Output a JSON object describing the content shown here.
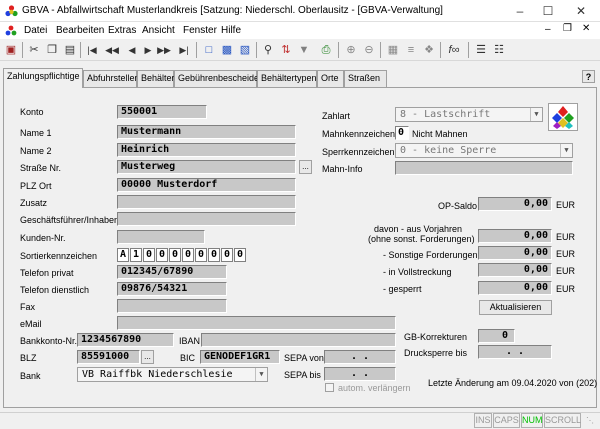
{
  "window": {
    "title": "GBVA - Abfallwirtschaft Musterlandkreis [Satzung: Niederschl. Oberlausitz - [GBVA-Verwaltung]"
  },
  "menu": [
    "Datei",
    "Bearbeiten",
    "Extras",
    "Ansicht",
    "Fenster",
    "Hilfe"
  ],
  "tabs": [
    "Zahlungspflichtige",
    "Abfuhrstellen",
    "Behälter",
    "Gebührenbescheide",
    "Behältertypen",
    "Orte",
    "Straßen"
  ],
  "help_label": "?",
  "form": {
    "konto": {
      "label": "Konto",
      "value": "550001"
    },
    "name1": {
      "label": "Name 1",
      "value": "Mustermann"
    },
    "name2": {
      "label": "Name 2",
      "value": "Heinrich"
    },
    "strasse": {
      "label": "Straße Nr.",
      "value": "Musterweg"
    },
    "plz_ort": {
      "label": "PLZ Ort",
      "value": "00000  Musterdorf"
    },
    "zusatz": {
      "label": "Zusatz",
      "value": ""
    },
    "geschaeftsfuehrer": {
      "label": "Geschäftsführer/Inhaber",
      "value": ""
    },
    "kunden_nr": {
      "label": "Kunden-Nr.",
      "value": ""
    },
    "sortierkennzeichen": {
      "label": "Sortierkennzeichen",
      "cells": [
        "A",
        "1",
        "0",
        "0",
        "0",
        "0",
        "0",
        "0",
        "0",
        "0"
      ]
    },
    "telefon_privat": {
      "label": "Telefon privat",
      "value": "012345/67890"
    },
    "telefon_dienstlich": {
      "label": "Telefon dienstlich",
      "value": "09876/54321"
    },
    "fax": {
      "label": "Fax",
      "value": ""
    },
    "email": {
      "label": "eMail",
      "value": ""
    },
    "bankkonto": {
      "label": "Bankkonto-Nr.",
      "value": "1234567890"
    },
    "iban": {
      "label": "IBAN",
      "value": ""
    },
    "blz": {
      "label": "BLZ",
      "value": "85591000"
    },
    "bic": {
      "label": "BIC",
      "value": "GENODEF1GR1"
    },
    "bank": {
      "label": "Bank",
      "value": "VB Raiffbk Niederschlesie"
    },
    "sepa_von": {
      "label": "SEPA von",
      "value": ". ."
    },
    "sepa_bis": {
      "label": "SEPA bis",
      "value": ". ."
    },
    "autom_verlaengern": {
      "label": "autom. verlängern"
    }
  },
  "right": {
    "zahlart": {
      "label": "Zahlart",
      "value": "8 - Lastschrift"
    },
    "mahnkennzeichen": {
      "label": "Mahnkennzeichen",
      "value": "0",
      "text": "Nicht Mahnen"
    },
    "sperrkennzeichen": {
      "label": "Sperrkennzeichen",
      "value": "0 - keine Sperre"
    },
    "mahn_info": {
      "label": "Mahn-Info",
      "value": ""
    },
    "op_saldo": {
      "label": "OP-Saldo",
      "value": "0,00",
      "unit": "EUR"
    },
    "vorjahre": {
      "label1": "davon - aus Vorjahren",
      "label2": "(ohne sonst. Forderungen)",
      "value": "0,00",
      "unit": "EUR"
    },
    "sonstige": {
      "label": "- Sonstige Forderungen",
      "value": "0,00",
      "unit": "EUR"
    },
    "vollstreckung": {
      "label": "- in Vollstreckung",
      "value": "0,00",
      "unit": "EUR"
    },
    "gesperrt": {
      "label": "- gesperrt",
      "value": "0,00",
      "unit": "EUR"
    },
    "aktualisieren": "Aktualisieren",
    "gb_korrekturen": {
      "label": "GB-Korrekturen",
      "value": "0"
    },
    "drucksperre": {
      "label": "Drucksperre bis",
      "value": ". ."
    },
    "last_change": "Letzte Änderung am 09.04.2020 von (202)"
  },
  "status": [
    "INS",
    "CAPS",
    "NUM",
    "SCROLL"
  ],
  "colors": {
    "num_active": "#00c000",
    "status_inactive": "#999999"
  }
}
